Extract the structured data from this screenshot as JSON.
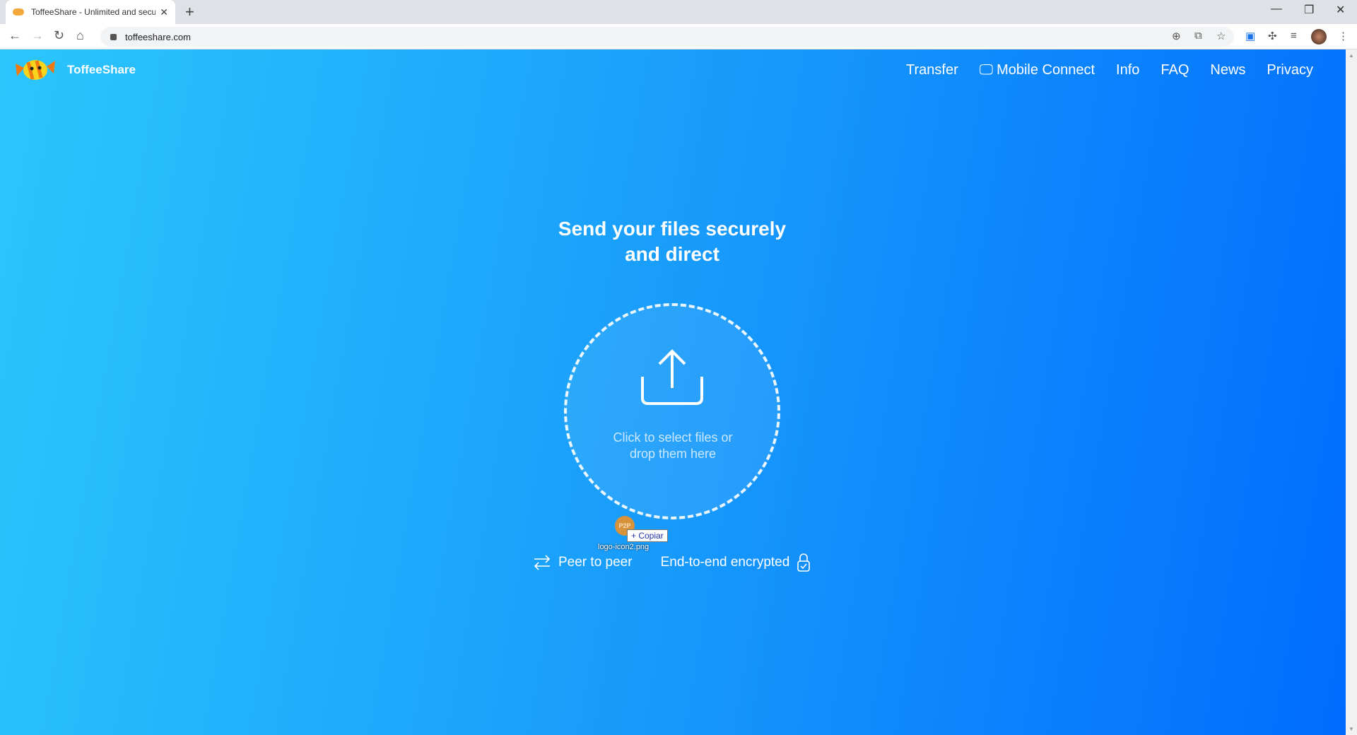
{
  "browser": {
    "tab_title": "ToffeeShare - Unlimited and secu",
    "url": "toffeeshare.com"
  },
  "site": {
    "brand": "ToffeeShare",
    "nav": [
      "Transfer",
      "Mobile Connect",
      "Info",
      "FAQ",
      "News",
      "Privacy"
    ]
  },
  "hero": {
    "title_line1": "Send your files securely",
    "title_line2": "and direct",
    "drop_message": "Click to select files or drop them here"
  },
  "drag": {
    "icon_text": "P2P",
    "action": "Copiar",
    "filename": "logo-icon2.png"
  },
  "features": [
    "Peer to peer",
    "End-to-end encrypted"
  ],
  "colors": {
    "gradient_start": "#2cc6fd",
    "gradient_end": "#006cfe"
  }
}
